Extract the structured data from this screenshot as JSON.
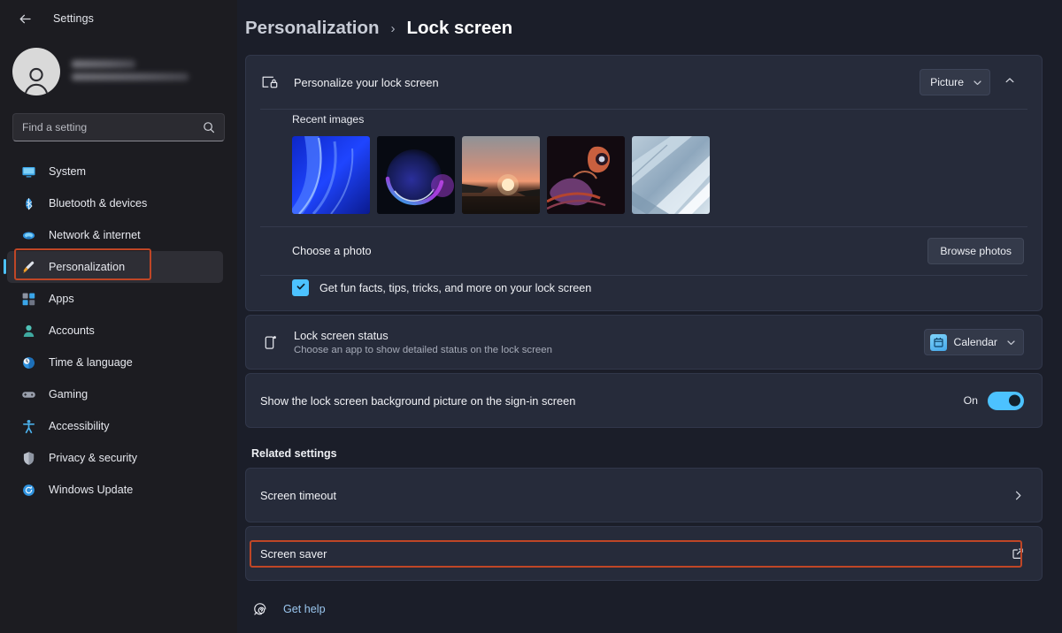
{
  "window": {
    "app_title": "Settings",
    "back_icon": "arrow-left-icon"
  },
  "account": {
    "name_redacted": "",
    "email_redacted": "",
    "avatar_icon": "user-avatar-icon"
  },
  "search": {
    "placeholder": "Find a setting",
    "value": "",
    "icon": "search-icon"
  },
  "sidebar": {
    "items": [
      {
        "label": "System",
        "icon": "monitor-icon",
        "selected": false
      },
      {
        "label": "Bluetooth & devices",
        "icon": "bluetooth-icon",
        "selected": false
      },
      {
        "label": "Network & internet",
        "icon": "globe-icon",
        "selected": false
      },
      {
        "label": "Personalization",
        "icon": "paintbrush-icon",
        "selected": true
      },
      {
        "label": "Apps",
        "icon": "apps-grid-icon",
        "selected": false
      },
      {
        "label": "Accounts",
        "icon": "accounts-icon",
        "selected": false
      },
      {
        "label": "Time & language",
        "icon": "clock-globe-icon",
        "selected": false
      },
      {
        "label": "Gaming",
        "icon": "gamepad-icon",
        "selected": false
      },
      {
        "label": "Accessibility",
        "icon": "accessibility-icon",
        "selected": false
      },
      {
        "label": "Privacy & security",
        "icon": "shield-icon",
        "selected": false
      },
      {
        "label": "Windows Update",
        "icon": "update-icon",
        "selected": false
      }
    ]
  },
  "breadcrumb": {
    "parent": "Personalization",
    "separator": "›",
    "current": "Lock screen"
  },
  "personalize_card": {
    "title": "Personalize your lock screen",
    "icon": "lock-screen-icon",
    "dropdown_value": "Picture",
    "dropdown_icon": "chevron-down-icon",
    "expander_icon": "chevron-up-icon",
    "recent_images_label": "Recent images",
    "thumbnails": [
      {
        "name": "blue-abstract-waves",
        "colors": [
          "#1a3cf0",
          "#2f6bff",
          "#0a1d8c"
        ]
      },
      {
        "name": "dark-purple-orb",
        "colors": [
          "#0a1020",
          "#2a2f9e",
          "#b03ad0"
        ]
      },
      {
        "name": "sunset-over-water",
        "colors": [
          "#8d8f92",
          "#e8917a",
          "#201a16"
        ]
      },
      {
        "name": "purple-red-swirl",
        "colors": [
          "#1a1016",
          "#6c3b6e",
          "#c4553a"
        ]
      },
      {
        "name": "light-blue-fabric",
        "colors": [
          "#c3d2de",
          "#8fa8bd",
          "#eef3f7"
        ]
      }
    ],
    "choose_photo_label": "Choose a photo",
    "browse_button": "Browse photos",
    "fun_facts_label": "Get fun facts, tips, tricks, and more on your lock screen",
    "fun_facts_checked": true,
    "check_icon": "checkmark-icon"
  },
  "status_card": {
    "title": "Lock screen status",
    "subtitle": "Choose an app to show detailed status on the lock screen",
    "icon": "lock-status-icon",
    "dropdown_value": "Calendar",
    "dropdown_app_icon": "calendar-app-icon",
    "dropdown_icon": "chevron-down-icon"
  },
  "signin_card": {
    "title": "Show the lock screen background picture on the sign-in screen",
    "toggle_state": "On",
    "toggle_on": true
  },
  "related_settings": {
    "heading": "Related settings",
    "items": [
      {
        "label": "Screen timeout",
        "trailing_icon": "chevron-right-icon",
        "highlighted": false
      },
      {
        "label": "Screen saver",
        "trailing_icon": "external-link-icon",
        "highlighted": true
      }
    ]
  },
  "footer": {
    "get_help_label": "Get help",
    "get_help_icon": "help-icon"
  },
  "colors": {
    "accent": "#4cc2ff",
    "highlight_box": "#bf4626",
    "card_bg": "#262b3a",
    "sidebar_bg": "#1c1c21",
    "page_bg": "#1b1e29"
  }
}
